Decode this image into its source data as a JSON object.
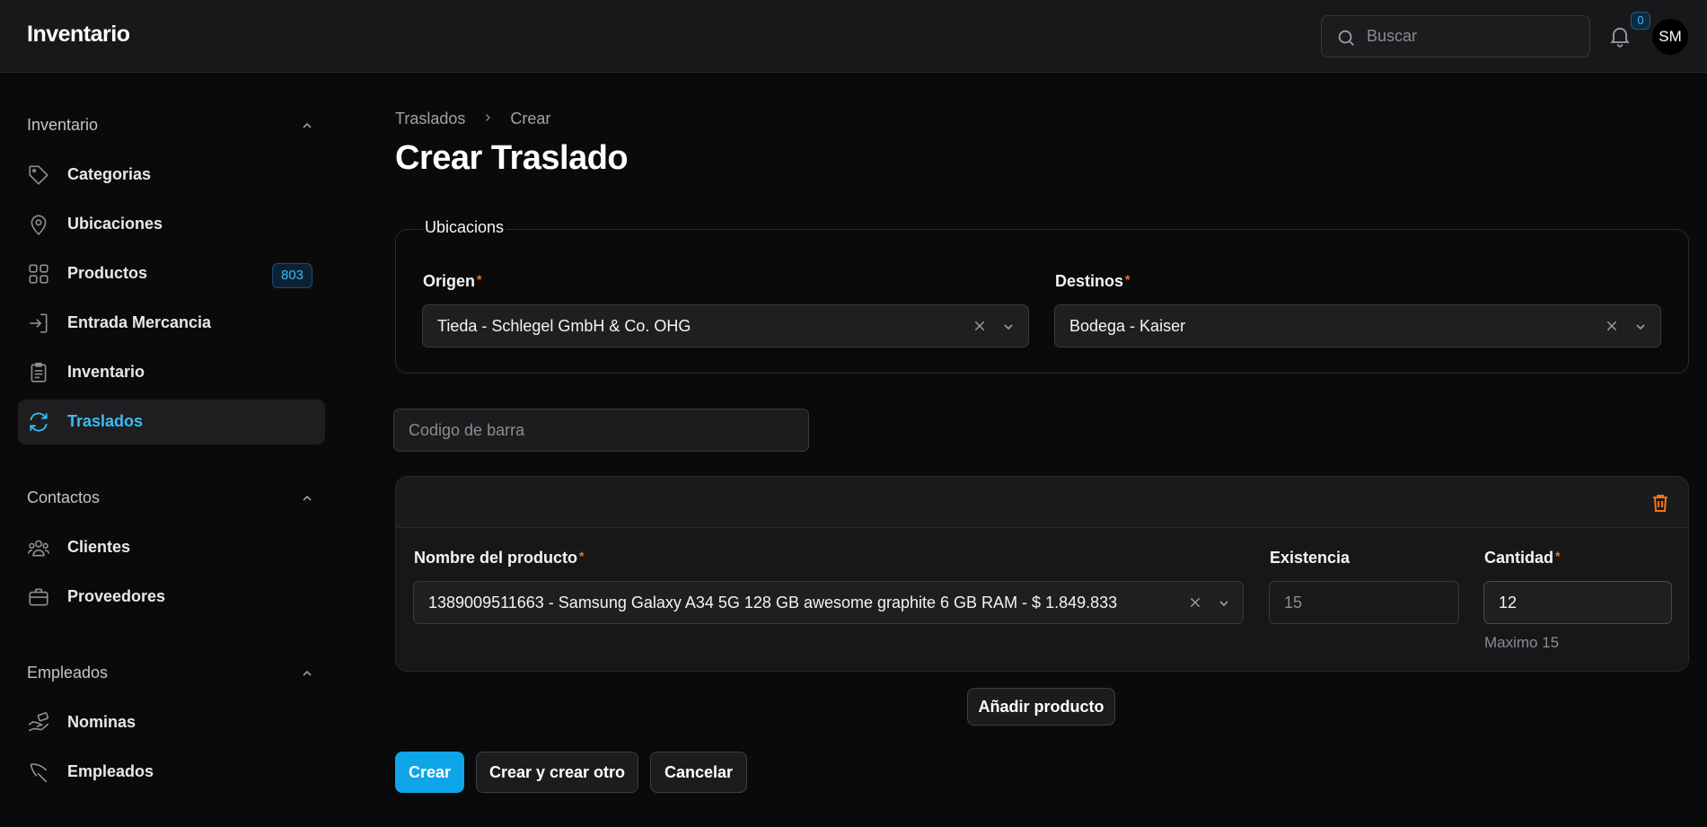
{
  "header": {
    "brand": "Inventario",
    "search_placeholder": "Buscar",
    "notification_count": "0",
    "avatar_initials": "SM"
  },
  "sidebar": {
    "groups": [
      {
        "title": "Inventario",
        "items": [
          {
            "label": "Categorias",
            "icon": "tag-icon"
          },
          {
            "label": "Ubicaciones",
            "icon": "map-pin-icon"
          },
          {
            "label": "Productos",
            "icon": "grid-icon",
            "badge": "803"
          },
          {
            "label": "Entrada Mercancia",
            "icon": "login-icon"
          },
          {
            "label": "Inventario",
            "icon": "clipboard-icon"
          },
          {
            "label": "Traslados",
            "icon": "refresh-icon",
            "active": true
          }
        ]
      },
      {
        "title": "Contactos",
        "items": [
          {
            "label": "Clientes",
            "icon": "users-icon"
          },
          {
            "label": "Proveedores",
            "icon": "briefcase-icon"
          }
        ]
      },
      {
        "title": "Empleados",
        "items": [
          {
            "label": "Nominas",
            "icon": "hand-cash-icon"
          },
          {
            "label": "Empleados",
            "icon": "pickaxe-icon"
          }
        ]
      }
    ]
  },
  "breadcrumb": {
    "parent": "Traslados",
    "current": "Crear"
  },
  "page_title": "Crear Traslado",
  "ubicaciones": {
    "legend": "Ubicacions",
    "origen_label": "Origen",
    "origen_value": "Tieda - Schlegel GmbH & Co. OHG",
    "destinos_label": "Destinos",
    "destinos_value": "Bodega - Kaiser",
    "required_mark": "*"
  },
  "barcode_placeholder": "Codigo de barra",
  "product_row": {
    "nombre_label": "Nombre del producto",
    "nombre_value": "1389009511663 - Samsung Galaxy A34 5G 128 GB awesome graphite 6 GB RAM - $ 1.849.833",
    "existencia_label": "Existencia",
    "existencia_value": "15",
    "cantidad_label": "Cantidad",
    "cantidad_value": "12",
    "cantidad_hint": "Maximo 15"
  },
  "add_product_label": "Añadir producto",
  "actions": {
    "create": "Crear",
    "create_another": "Crear y crear otro",
    "cancel": "Cancelar"
  },
  "colors": {
    "accent": "#0ea5e9",
    "active_text": "#38bdf8",
    "required": "#f97316",
    "background": "#0a0a0b"
  }
}
